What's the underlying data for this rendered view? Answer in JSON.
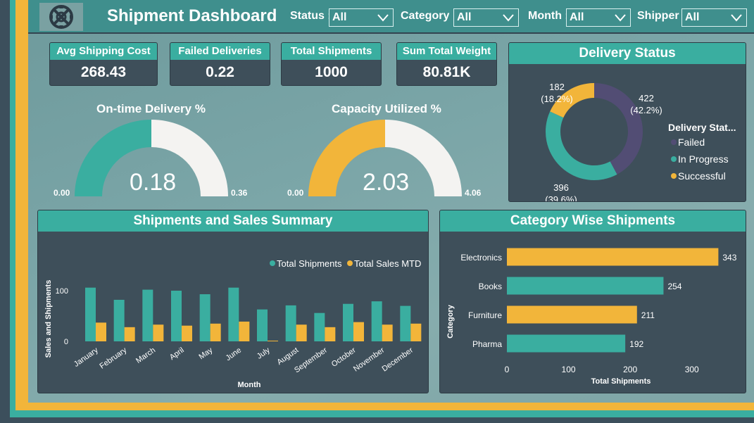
{
  "header": {
    "title": "Shipment Dashboard"
  },
  "filters": [
    {
      "label": "Status :",
      "value": "All"
    },
    {
      "label": "Category :",
      "value": "All"
    },
    {
      "label": "Month :",
      "value": "All"
    },
    {
      "label": "Shipper :",
      "value": "All"
    }
  ],
  "kpis": [
    {
      "label": "Avg Shipping Cost",
      "value": "268.43"
    },
    {
      "label": "Failed Deliveries",
      "value": "0.22"
    },
    {
      "label": "Total Shipments",
      "value": "1000"
    },
    {
      "label": "Sum Total Weight",
      "value": "80.81K"
    }
  ],
  "colors": {
    "teal": "#3aaea0",
    "gold": "#f2b53a",
    "purple": "#524d74",
    "panel": "#3e4f5a",
    "gauge_rest": "#f4f3f1"
  },
  "icons": {
    "logo": "shield-emblem-icon",
    "dropdown": "chevron-down-icon"
  },
  "chart_data": [
    {
      "type": "gauge",
      "title": "On-time Delivery %",
      "value": 0.18,
      "value_label": "0.18",
      "min": 0,
      "max": 0.36,
      "min_label": "0.00",
      "max_label": "0.36",
      "color": "#3aaea0"
    },
    {
      "type": "gauge",
      "title": "Capacity Utilized %",
      "value": 2.03,
      "value_label": "2.03",
      "min": 0,
      "max": 4.06,
      "min_label": "0.00",
      "max_label": "4.06",
      "color": "#f2b53a"
    },
    {
      "type": "pie",
      "title": "Delivery Status",
      "legend_title": "Delivery Stat...",
      "legend_position": "right",
      "slices": [
        {
          "name": "Failed",
          "value": 422,
          "label": "422",
          "pct": "(42.2%)",
          "color": "#524d74"
        },
        {
          "name": "In Progress",
          "value": 396,
          "label": "396",
          "pct": "(39.6%)",
          "color": "#3aaea0"
        },
        {
          "name": "Successful",
          "value": 182,
          "label": "182",
          "pct": "(18.2%)",
          "color": "#f2b53a"
        }
      ]
    },
    {
      "type": "bar",
      "title": "Shipments and Sales Summary",
      "xlabel": "Month",
      "ylabel": "Sales and Shipments",
      "ylim": [
        0,
        120
      ],
      "yticks": [
        "0",
        "100"
      ],
      "legend_position": "top-right",
      "categories": [
        "January",
        "February",
        "March",
        "April",
        "May",
        "June",
        "July",
        "August",
        "September",
        "October",
        "November",
        "December"
      ],
      "series": [
        {
          "name": "Total Shipments",
          "color": "#3aaea0",
          "values": [
            106,
            82,
            102,
            100,
            93,
            106,
            63,
            71,
            56,
            74,
            79,
            70
          ]
        },
        {
          "name": "Total Sales MTD",
          "color": "#f2b53a",
          "values": [
            37,
            28,
            33,
            31,
            35,
            39,
            1,
            33,
            28,
            38,
            33,
            35
          ]
        }
      ]
    },
    {
      "type": "bar",
      "orientation": "horizontal",
      "title": "Category Wise Shipments",
      "xlabel": "Total Shipments",
      "ylabel": "Category",
      "xlim": [
        0,
        350
      ],
      "xticks": [
        "0",
        "100",
        "200",
        "300"
      ],
      "categories": [
        "Electronics",
        "Books",
        "Furniture",
        "Pharma"
      ],
      "values": [
        343,
        254,
        211,
        192
      ],
      "colors": [
        "#f2b53a",
        "#3aaea0",
        "#f2b53a",
        "#3aaea0"
      ]
    }
  ]
}
